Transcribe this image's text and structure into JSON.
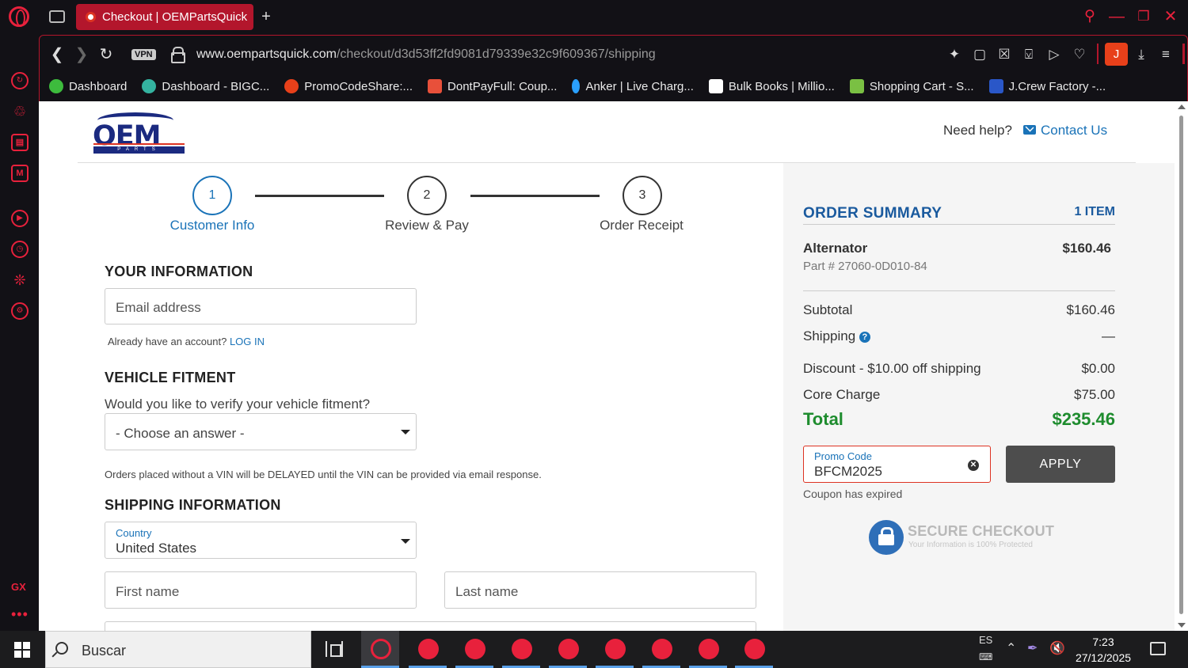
{
  "browser": {
    "tab_title": "Checkout | OEMPartsQuick",
    "vpn_label": "VPN",
    "url_host": "www.oempartsquick.com",
    "url_path": "/checkout/d3d53ff2fd9081d79339e32c9f609367/shipping",
    "profile_initial": "J",
    "bookmarks": [
      {
        "label": "Dashboard",
        "color": "#3dbb3d"
      },
      {
        "label": "Dashboard - BIGC...",
        "color": "#34b3a0"
      },
      {
        "label": "PromoCodeShare:...",
        "color": "#e8401a"
      },
      {
        "label": "DontPayFull: Coup...",
        "color": "#e8503a"
      },
      {
        "label": "Anker | Live Charg...",
        "color": "#2aa0ff"
      },
      {
        "label": "Bulk Books | Millio...",
        "color": "#ffffff"
      },
      {
        "label": "Shopping Cart - S...",
        "color": "#7ac043"
      },
      {
        "label": "J.Crew Factory -...",
        "color": "#2a57c8"
      }
    ]
  },
  "header": {
    "logo_text": "OEM",
    "logo_sub": "PARTS QUICK",
    "need_help": "Need help?",
    "contact": "Contact Us"
  },
  "steps": [
    {
      "number": "1",
      "label": "Customer Info",
      "active": true
    },
    {
      "number": "2",
      "label": "Review & Pay",
      "active": false
    },
    {
      "number": "3",
      "label": "Order Receipt",
      "active": false
    }
  ],
  "form": {
    "your_info_title": "YOUR INFORMATION",
    "email_placeholder": "Email address",
    "account_prompt": "Already have an account?",
    "login_link": "LOG IN",
    "fitment_title": "VEHICLE FITMENT",
    "fitment_question": "Would you like to verify your vehicle fitment?",
    "fitment_select": "- Choose an answer -",
    "vin_note": "Orders placed without a VIN will be DELAYED until the VIN can be provided via email response.",
    "shipping_title": "SHIPPING INFORMATION",
    "country_label": "Country",
    "country_value": "United States",
    "first_name_placeholder": "First name",
    "last_name_placeholder": "Last name"
  },
  "summary": {
    "title": "ORDER SUMMARY",
    "item_count": "1 ITEM",
    "item_name": "Alternator",
    "item_price": "$160.46",
    "item_part": "Part # 27060-0D010-84",
    "subtotal_label": "Subtotal",
    "subtotal_value": "$160.46",
    "shipping_label": "Shipping",
    "shipping_value": "—",
    "discount_label": "Discount - $10.00 off shipping",
    "discount_value": "$0.00",
    "core_label": "Core Charge",
    "core_value": "$75.00",
    "total_label": "Total",
    "total_value": "$235.46",
    "promo_label": "Promo Code",
    "promo_value": "BFCM2025",
    "apply_label": "APPLY",
    "coupon_message": "Coupon has expired",
    "secure_title": "SECURE CHECKOUT",
    "secure_sub": "Your Information is 100% Protected"
  },
  "taskbar": {
    "search_placeholder": "Buscar",
    "language": "ES",
    "time": "7:23",
    "date": "27/12/2025"
  },
  "sidebar": {
    "gx_label": "GX",
    "more_label": "•••"
  }
}
